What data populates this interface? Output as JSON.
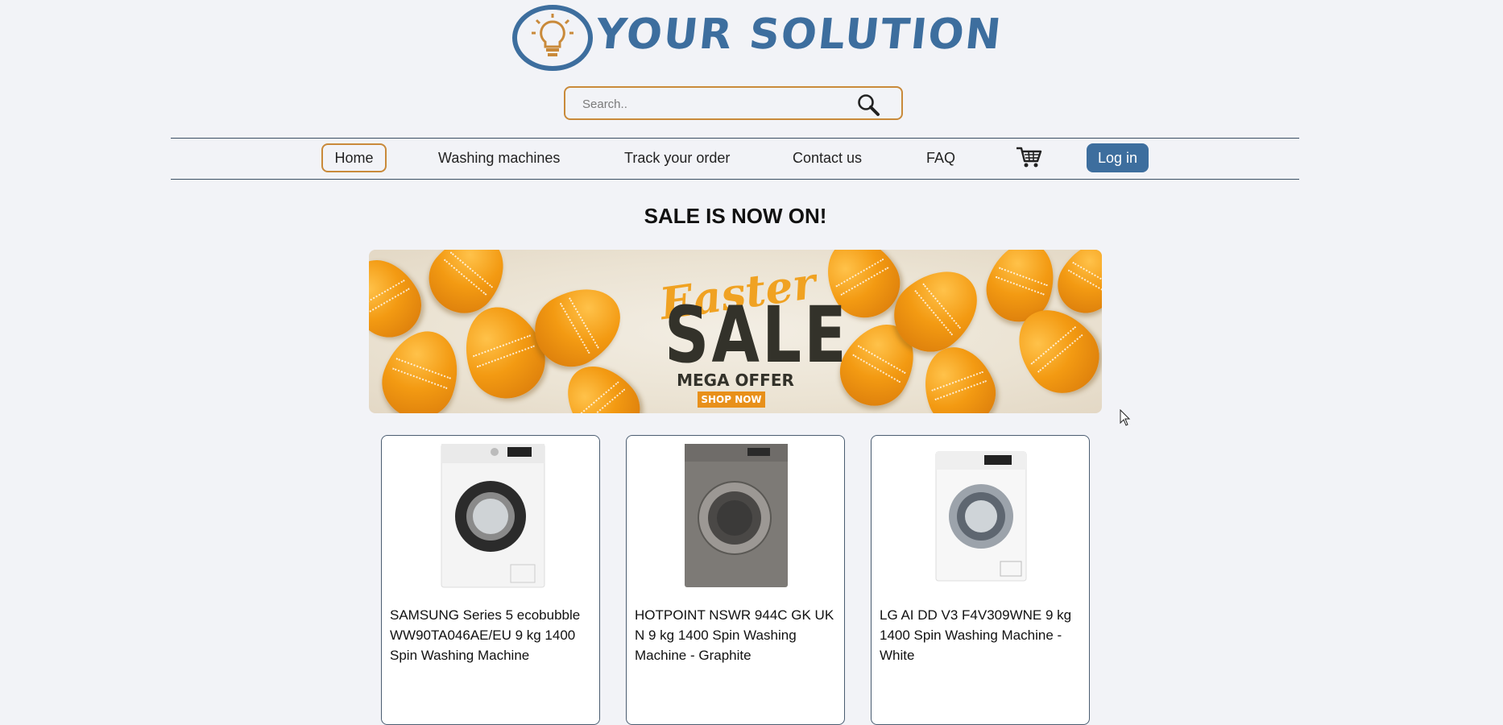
{
  "header": {
    "logo_text": "YOUR SOLUTION",
    "logo_icon": "lightbulb-icon",
    "brand_color": "#3d6e9e"
  },
  "search": {
    "placeholder": "Search..",
    "icon": "search-icon"
  },
  "nav": {
    "items": [
      {
        "label": "Home",
        "active": true
      },
      {
        "label": "Washing machines"
      },
      {
        "label": "Track your order"
      },
      {
        "label": "Contact us"
      },
      {
        "label": "FAQ"
      }
    ],
    "cart_icon": "cart-icon",
    "login_label": "Log in",
    "accent_color": "#c98a3a"
  },
  "main": {
    "sale_heading": "SALE IS NOW ON!",
    "banner": {
      "easter": "Easter",
      "sale": "SALE",
      "mega_offer": "MEGA OFFER",
      "shop_now": "SHOP NOW"
    },
    "products": [
      {
        "title": "SAMSUNG Series 5 ecobubble WW90TA046AE/EU 9 kg 1400 Spin Washing Machine",
        "color": "white"
      },
      {
        "title": "HOTPOINT NSWR 944C GK UK N 9 kg 1400 Spin Washing Machine - Graphite",
        "color": "graphite"
      },
      {
        "title": "LG AI DD V3 F4V309WNE 9 kg 1400 Spin Washing Machine - White",
        "color": "white"
      }
    ]
  }
}
